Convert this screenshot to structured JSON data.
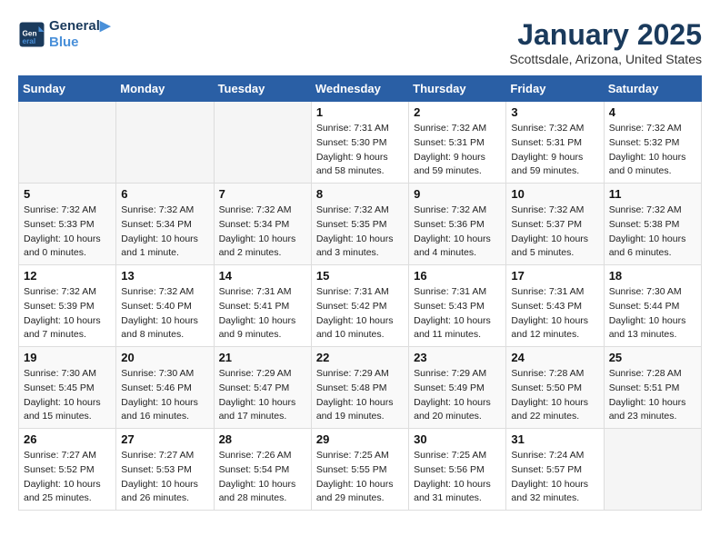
{
  "header": {
    "logo_line1": "General",
    "logo_line2": "Blue",
    "month": "January 2025",
    "location": "Scottsdale, Arizona, United States"
  },
  "weekdays": [
    "Sunday",
    "Monday",
    "Tuesday",
    "Wednesday",
    "Thursday",
    "Friday",
    "Saturday"
  ],
  "weeks": [
    [
      {
        "day": "",
        "empty": true
      },
      {
        "day": "",
        "empty": true
      },
      {
        "day": "",
        "empty": true
      },
      {
        "day": "1",
        "sunrise": "7:31 AM",
        "sunset": "5:30 PM",
        "daylight": "9 hours and 58 minutes."
      },
      {
        "day": "2",
        "sunrise": "7:32 AM",
        "sunset": "5:31 PM",
        "daylight": "9 hours and 59 minutes."
      },
      {
        "day": "3",
        "sunrise": "7:32 AM",
        "sunset": "5:31 PM",
        "daylight": "9 hours and 59 minutes."
      },
      {
        "day": "4",
        "sunrise": "7:32 AM",
        "sunset": "5:32 PM",
        "daylight": "10 hours and 0 minutes."
      }
    ],
    [
      {
        "day": "5",
        "sunrise": "7:32 AM",
        "sunset": "5:33 PM",
        "daylight": "10 hours and 0 minutes."
      },
      {
        "day": "6",
        "sunrise": "7:32 AM",
        "sunset": "5:34 PM",
        "daylight": "10 hours and 1 minute."
      },
      {
        "day": "7",
        "sunrise": "7:32 AM",
        "sunset": "5:34 PM",
        "daylight": "10 hours and 2 minutes."
      },
      {
        "day": "8",
        "sunrise": "7:32 AM",
        "sunset": "5:35 PM",
        "daylight": "10 hours and 3 minutes."
      },
      {
        "day": "9",
        "sunrise": "7:32 AM",
        "sunset": "5:36 PM",
        "daylight": "10 hours and 4 minutes."
      },
      {
        "day": "10",
        "sunrise": "7:32 AM",
        "sunset": "5:37 PM",
        "daylight": "10 hours and 5 minutes."
      },
      {
        "day": "11",
        "sunrise": "7:32 AM",
        "sunset": "5:38 PM",
        "daylight": "10 hours and 6 minutes."
      }
    ],
    [
      {
        "day": "12",
        "sunrise": "7:32 AM",
        "sunset": "5:39 PM",
        "daylight": "10 hours and 7 minutes."
      },
      {
        "day": "13",
        "sunrise": "7:32 AM",
        "sunset": "5:40 PM",
        "daylight": "10 hours and 8 minutes."
      },
      {
        "day": "14",
        "sunrise": "7:31 AM",
        "sunset": "5:41 PM",
        "daylight": "10 hours and 9 minutes."
      },
      {
        "day": "15",
        "sunrise": "7:31 AM",
        "sunset": "5:42 PM",
        "daylight": "10 hours and 10 minutes."
      },
      {
        "day": "16",
        "sunrise": "7:31 AM",
        "sunset": "5:43 PM",
        "daylight": "10 hours and 11 minutes."
      },
      {
        "day": "17",
        "sunrise": "7:31 AM",
        "sunset": "5:43 PM",
        "daylight": "10 hours and 12 minutes."
      },
      {
        "day": "18",
        "sunrise": "7:30 AM",
        "sunset": "5:44 PM",
        "daylight": "10 hours and 13 minutes."
      }
    ],
    [
      {
        "day": "19",
        "sunrise": "7:30 AM",
        "sunset": "5:45 PM",
        "daylight": "10 hours and 15 minutes."
      },
      {
        "day": "20",
        "sunrise": "7:30 AM",
        "sunset": "5:46 PM",
        "daylight": "10 hours and 16 minutes."
      },
      {
        "day": "21",
        "sunrise": "7:29 AM",
        "sunset": "5:47 PM",
        "daylight": "10 hours and 17 minutes."
      },
      {
        "day": "22",
        "sunrise": "7:29 AM",
        "sunset": "5:48 PM",
        "daylight": "10 hours and 19 minutes."
      },
      {
        "day": "23",
        "sunrise": "7:29 AM",
        "sunset": "5:49 PM",
        "daylight": "10 hours and 20 minutes."
      },
      {
        "day": "24",
        "sunrise": "7:28 AM",
        "sunset": "5:50 PM",
        "daylight": "10 hours and 22 minutes."
      },
      {
        "day": "25",
        "sunrise": "7:28 AM",
        "sunset": "5:51 PM",
        "daylight": "10 hours and 23 minutes."
      }
    ],
    [
      {
        "day": "26",
        "sunrise": "7:27 AM",
        "sunset": "5:52 PM",
        "daylight": "10 hours and 25 minutes."
      },
      {
        "day": "27",
        "sunrise": "7:27 AM",
        "sunset": "5:53 PM",
        "daylight": "10 hours and 26 minutes."
      },
      {
        "day": "28",
        "sunrise": "7:26 AM",
        "sunset": "5:54 PM",
        "daylight": "10 hours and 28 minutes."
      },
      {
        "day": "29",
        "sunrise": "7:25 AM",
        "sunset": "5:55 PM",
        "daylight": "10 hours and 29 minutes."
      },
      {
        "day": "30",
        "sunrise": "7:25 AM",
        "sunset": "5:56 PM",
        "daylight": "10 hours and 31 minutes."
      },
      {
        "day": "31",
        "sunrise": "7:24 AM",
        "sunset": "5:57 PM",
        "daylight": "10 hours and 32 minutes."
      },
      {
        "day": "",
        "empty": true
      }
    ]
  ],
  "labels": {
    "sunrise": "Sunrise:",
    "sunset": "Sunset:",
    "daylight": "Daylight:"
  }
}
